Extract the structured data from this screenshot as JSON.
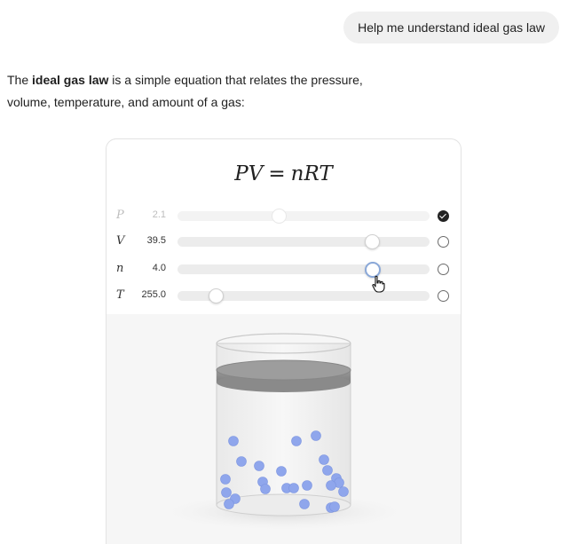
{
  "user_message": "Help me understand ideal gas law",
  "intro": {
    "prefix": "The ",
    "bold": "ideal gas law",
    "suffix": " is a simple equation that relates the pressure, volume, temperature, and amount of a gas:"
  },
  "equation": {
    "lhs": "PV",
    "equals": "=",
    "rhs": "nRT"
  },
  "variables": [
    {
      "symbol": "P",
      "value": "2.1",
      "slider_fraction": 0.4,
      "locked": true,
      "active": false
    },
    {
      "symbol": "V",
      "value": "39.5",
      "slider_fraction": 0.77,
      "locked": false,
      "active": false
    },
    {
      "symbol": "n",
      "value": "4.0",
      "slider_fraction": 0.77,
      "locked": false,
      "active": true
    },
    {
      "symbol": "T",
      "value": "255.0",
      "slider_fraction": 0.15,
      "locked": false,
      "active": false
    }
  ],
  "colors": {
    "particle": "#8fa6ec",
    "particle_stroke": "#7d95e0",
    "piston": "#8a8a8a",
    "accent_active": "#8aa8d8"
  },
  "icons": {
    "lock_checked": "check-circle-icon",
    "lock_unchecked": "radio-empty-icon",
    "cursor": "hand-pointer-icon"
  }
}
